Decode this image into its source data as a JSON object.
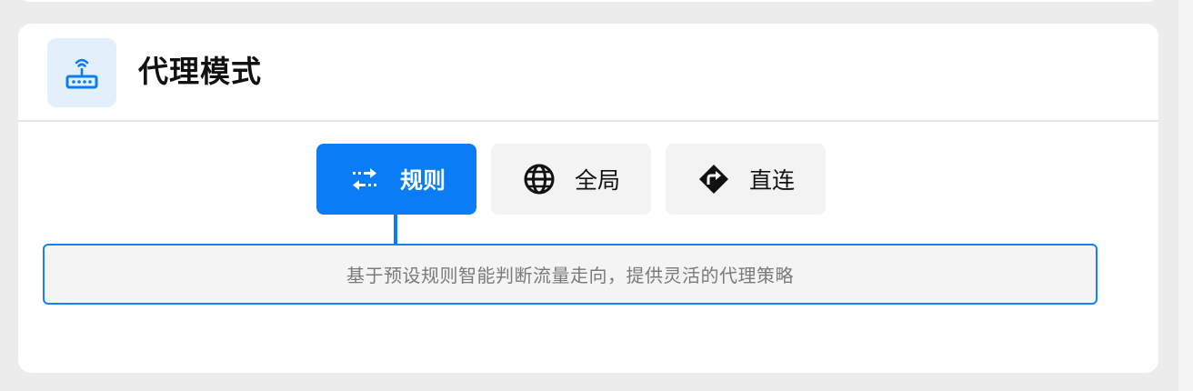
{
  "section": {
    "title": "代理模式",
    "icon": "router-icon"
  },
  "modes": [
    {
      "id": "rule",
      "label": "规则",
      "icon": "swap-arrows-icon",
      "active": true
    },
    {
      "id": "global",
      "label": "全局",
      "icon": "globe-icon",
      "active": false
    },
    {
      "id": "direct",
      "label": "直连",
      "icon": "direction-sign-icon",
      "active": false
    }
  ],
  "description": "基于预设规则智能判断流量走向，提供灵活的代理策略",
  "colors": {
    "accent": "#0a7cf5",
    "icon_bg": "#e4effc",
    "button_bg": "#f3f3f3",
    "page_bg": "#ececec"
  }
}
